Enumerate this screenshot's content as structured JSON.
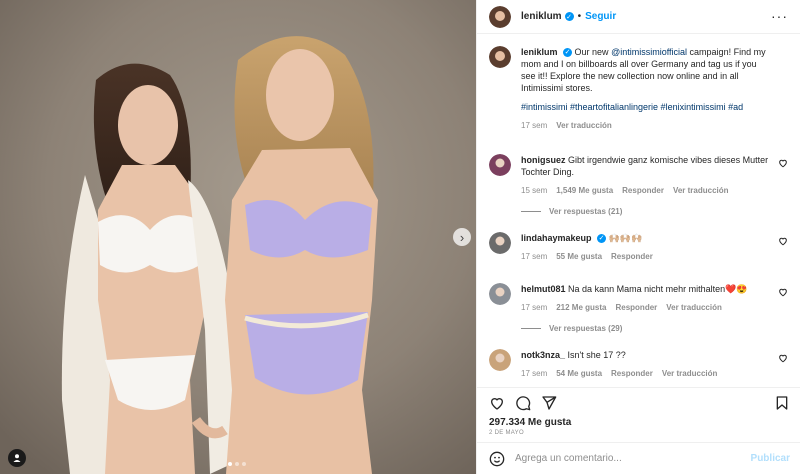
{
  "post": {
    "media": {
      "next_icon": "chevron-right-icon",
      "tag_icon": "user-tag-icon",
      "carousel_total": 3,
      "carousel_active": 1
    },
    "header": {
      "username": "leniklum",
      "separator": "•",
      "follow_label": "Seguir",
      "more_icon": "more-options-icon",
      "more_label": "···"
    },
    "caption": {
      "username": "leniklum",
      "text_before": "Our new ",
      "mention": "@intimissimiofficial",
      "text_after": " campaign! Find my mom and I on billboards all over Germany and tag us if you see it!! Explore the new collection now online and in all Intimissimi stores.",
      "hashtags": "#intimissimi #theartofitalianlingerie #lenixintimissimi #ad",
      "time": "17 sem",
      "translate": "Ver traducción"
    },
    "comments": [
      {
        "username": "honigsuez",
        "text": "Gibt irgendwie ganz komische vibes dieses Mutter Tochter Ding.",
        "time": "15 sem",
        "likes": "1,549 Me gusta",
        "reply": "Responder",
        "translate": "Ver traducción",
        "replies": "Ver respuestas (21)",
        "verified": false,
        "avatar_color": "#7b3f5e"
      },
      {
        "username": "lindahaymakeup",
        "text": "🙌🏼🙌🏼🙌🏼",
        "time": "17 sem",
        "likes": "55 Me gusta",
        "reply": "Responder",
        "translate": "",
        "replies": "",
        "verified": true,
        "avatar_color": "#6b6b6b"
      },
      {
        "username": "helmut081",
        "text": "Na da kann Mama nicht mehr mithalten❤️😍",
        "time": "17 sem",
        "likes": "212 Me gusta",
        "reply": "Responder",
        "translate": "Ver traducción",
        "replies": "Ver respuestas (29)",
        "verified": false,
        "avatar_color": "#8a8f96"
      },
      {
        "username": "notk3nza_",
        "text": "Isn't she 17 ??",
        "time": "17 sem",
        "likes": "54 Me gusta",
        "reply": "Responder",
        "translate": "Ver traducción",
        "replies": "",
        "verified": false,
        "avatar_color": "#c9a37a"
      }
    ],
    "actions": {
      "like_icon": "heart-icon",
      "comment_icon": "comment-icon",
      "share_icon": "share-icon",
      "save_icon": "bookmark-icon"
    },
    "likes": "297.334 Me gusta",
    "date": "2 DE MAYO",
    "add_comment": {
      "emoji_icon": "emoji-icon",
      "placeholder": "Agrega un comentario...",
      "publish": "Publicar"
    },
    "colors": {
      "accent": "#0095f6",
      "muted": "#8e8e8e",
      "text": "#262626",
      "publish_disabled": "#b2dffc",
      "like_red": "#ed4956"
    }
  }
}
